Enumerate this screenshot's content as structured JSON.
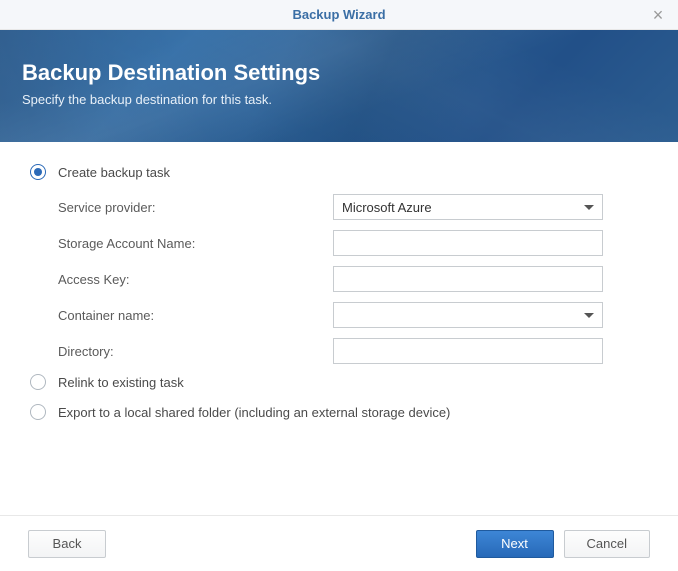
{
  "window": {
    "title": "Backup Wizard"
  },
  "banner": {
    "title": "Backup Destination Settings",
    "subtitle": "Specify the backup destination for this task."
  },
  "options": {
    "create": {
      "label": "Create backup task",
      "selected": true
    },
    "relink": {
      "label": "Relink to existing task",
      "selected": false
    },
    "export": {
      "label": "Export to a local shared folder (including an external storage device)",
      "selected": false
    }
  },
  "fields": {
    "service_provider": {
      "label": "Service provider:",
      "value": "Microsoft Azure",
      "type": "select"
    },
    "storage_account": {
      "label": "Storage Account Name:",
      "value": "",
      "type": "text"
    },
    "access_key": {
      "label": "Access Key:",
      "value": "",
      "type": "text"
    },
    "container_name": {
      "label": "Container name:",
      "value": "",
      "type": "select"
    },
    "directory": {
      "label": "Directory:",
      "value": "",
      "type": "text"
    }
  },
  "buttons": {
    "back": "Back",
    "next": "Next",
    "cancel": "Cancel"
  }
}
